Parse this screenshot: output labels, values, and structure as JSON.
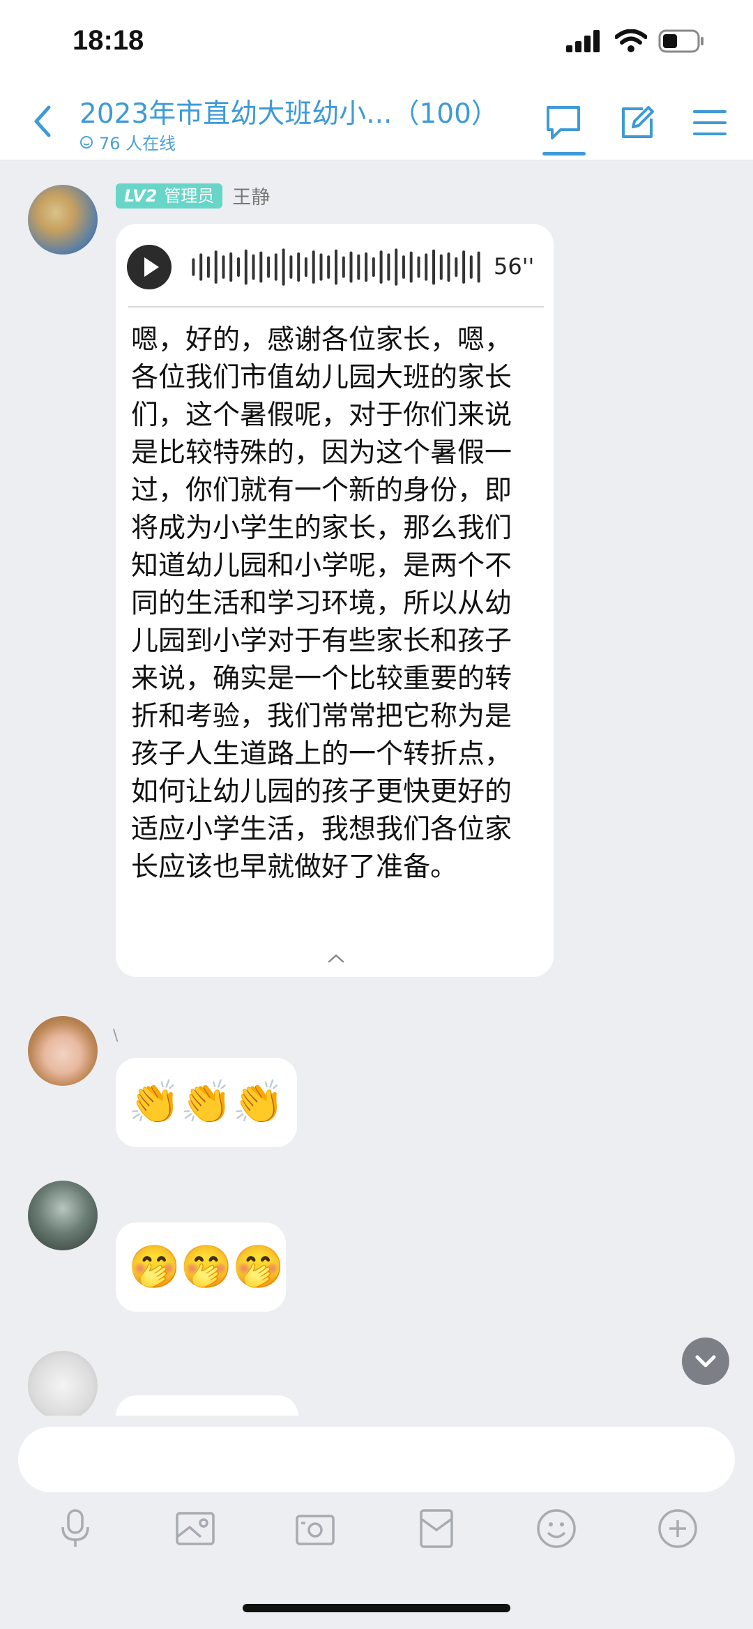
{
  "status_bar": {
    "time": "18:18",
    "icons": [
      "signal-icon",
      "wifi-icon",
      "battery-icon"
    ]
  },
  "header": {
    "title": "2023年市直幼大班幼小...（100）",
    "online": "76 人在线",
    "accent_color": "#3d9ad6",
    "icons": [
      "back-icon",
      "chat-icon",
      "edit-icon",
      "menu-icon"
    ]
  },
  "messages": [
    {
      "type": "voice",
      "level": "LV2",
      "role": "管理员",
      "sender": "王静",
      "duration": "56''",
      "transcript": "嗯，好的，感谢各位家长，嗯，各位我们市值幼儿园大班的家长们，这个暑假呢，对于你们来说是比较特殊的，因为这个暑假一过，你们就有一个新的身份，即将成为小学生的家长，那么我们知道幼儿园和小学呢，是两个不同的生活和学习环境，所以从幼儿园到小学对于有些家长和孩子来说，确实是一个比较重要的转折和考验，我们常常把它称为是孩子人生道路上的一个转折点，如何让幼儿园的孩子更快更好的适应小学生活，我想我们各位家长应该也早就做好了准备。"
    },
    {
      "type": "emoji",
      "sender_mark": "\\",
      "content": "👏👏👏"
    },
    {
      "type": "emoji",
      "content": "🤭🤭🤭"
    }
  ],
  "toolbar": [
    "microphone-icon",
    "image-icon",
    "camera-icon",
    "red-packet-icon",
    "emoji-icon",
    "plus-icon"
  ]
}
